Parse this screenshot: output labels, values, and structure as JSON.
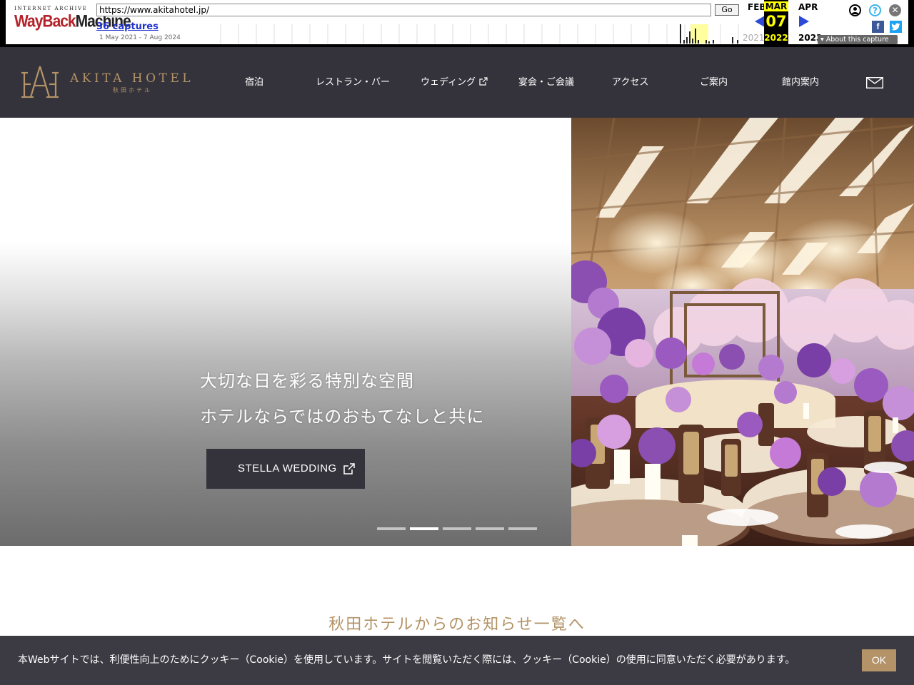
{
  "wayback": {
    "logo_top": "INTERNET ARCHIVE",
    "logo_way": "WayBack",
    "logo_machine": "Machine",
    "url": "https://www.akitahotel.jp/",
    "go_label": "Go",
    "captures_label": "36 captures",
    "date_range": "1 May 2021 - 7 Aug 2024",
    "prev_month": "FEB",
    "cur_month": "MAR",
    "cur_day": "07",
    "next_month": "APR",
    "prev_year": "2021",
    "cur_year": "2022",
    "next_year": "2023",
    "about_label": "About this capture",
    "help_glyph": "?"
  },
  "header": {
    "logo_text": "AKITA HOTEL",
    "logo_sub": "秋田ホテル",
    "nav": [
      {
        "label": "宿泊"
      },
      {
        "label": "レストラン・バー"
      },
      {
        "label": "ウェディング"
      },
      {
        "label": "宴会・ご会議"
      },
      {
        "label": "アクセス"
      },
      {
        "label": "ご案内"
      },
      {
        "label": "館内案内"
      }
    ]
  },
  "hero": {
    "line1": "大切な日を彩る特別な空間",
    "line2": "ホテルならではのおもてなしと共に",
    "button_label": "STELLA WEDDING",
    "slide_count": 5,
    "active_slide": 2
  },
  "section": {
    "title": "秋田ホテルからのお知らせ一覧へ"
  },
  "cookie": {
    "text": "本Webサイトでは、利便性向上のためにクッキー（Cookie）を使用しています。サイトを閲覧いただく際には、クッキー（Cookie）の使用に同意いただく必要があります。",
    "ok_label": "OK"
  },
  "colors": {
    "header_bg": "#34333b",
    "gold": "#b39367",
    "cookie_bg": "#3c3b43"
  }
}
